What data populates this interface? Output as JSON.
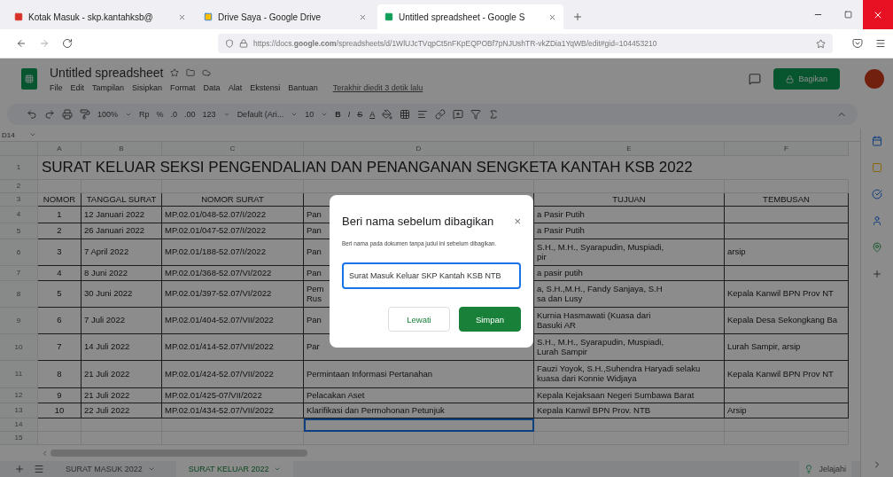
{
  "browser": {
    "tabs": [
      {
        "title": "Kotak Masuk - skp.kantahksb@",
        "selected": false
      },
      {
        "title": "Drive Saya - Google Drive",
        "selected": false
      },
      {
        "title": "Untitled spreadsheet - Google S",
        "selected": true
      }
    ],
    "url": "https://docs.**google.com**/spreadsheets/d/1WlUJcTVqpCt5nFKpEQPOBf7pNJUshTR-vkZDia1YqWB/edit#gid=104453210"
  },
  "document": {
    "title": "Untitled spreadsheet",
    "menu": [
      "File",
      "Edit",
      "Tampilan",
      "Sisipkan",
      "Format",
      "Data",
      "Alat",
      "Ekstensi",
      "Bantuan"
    ],
    "last_edit": "Terakhir diedit 3 detik lalu",
    "share_button": "Bagikan"
  },
  "toolbar": {
    "zoom": "100%",
    "currency": "Rp",
    "percent": "%",
    "decimal_less": ".0",
    "decimal_more": ".00",
    "number_format": "123",
    "font": "Default (Ari...",
    "font_size": "10",
    "bold": "B",
    "italic": "I",
    "strike": "S",
    "text_color": "A"
  },
  "name_box": "D14",
  "sheet": {
    "columns": [
      "A",
      "B",
      "C",
      "D",
      "E",
      "F"
    ],
    "rows": [
      {
        "number": "1",
        "kind": "title",
        "text": "SURAT KELUAR SEKSI PENGENDALIAN DAN PENANGANAN SENGKETA KANTAH KSB 2022"
      },
      {
        "number": "2",
        "kind": "blank"
      },
      {
        "number": "3",
        "kind": "header",
        "cells": {
          "A": "NOMOR",
          "B": "TANGGAL SURAT",
          "C": "NOMOR SURAT",
          "E": "TUJUAN",
          "F": "TEMBUSAN"
        }
      },
      {
        "number": "4",
        "kind": "data",
        "cells": {
          "A": "1",
          "B": "12 Januari 2022",
          "C": "MP.02.01/048-52.07/I/2022",
          "D": "Pan",
          "E": "a Pasir Putih"
        }
      },
      {
        "number": "5",
        "kind": "data",
        "cells": {
          "A": "2",
          "B": "26 Januari 2022",
          "C": "MP.02.01/047-52.07/I/2022",
          "D": "Pan",
          "E": "a Pasir Putih"
        }
      },
      {
        "number": "6",
        "kind": "data",
        "cells": {
          "A": "3",
          "B": "7 April 2022",
          "C": "MP.02.01/188-52.07/I/2022",
          "D": "Pan",
          "E": "S.H., M.H., Syarapudin, Muspiadi,\npir",
          "F": "arsip"
        }
      },
      {
        "number": "7",
        "kind": "data",
        "cells": {
          "A": "4",
          "B": "8 Juni 2022",
          "C": "MP.02.01/368-52.07/VI/2022",
          "D": "Pan",
          "E": "a pasir putih"
        }
      },
      {
        "number": "8",
        "kind": "data",
        "cells": {
          "A": "5",
          "B": "30 Juni 2022",
          "C": "MP.02.01/397-52.07/VI/2022",
          "D": "Pem\nRus",
          "E": "a, S.H.,M.H., Fandy Sanjaya, S.H\nsa dan Lusy",
          "F": "Kepala Kanwil BPN Prov NT"
        }
      },
      {
        "number": "9",
        "kind": "data",
        "cells": {
          "A": "6",
          "B": "7 Juli 2022",
          "C": "MP.02.01/404-52.07/VII/2022",
          "D": "Pan",
          "E": "Kurnia Hasmawati (Kuasa dari\nBasuki AR",
          "F": "Kepala Desa Sekongkang Ba"
        }
      },
      {
        "number": "10",
        "kind": "data",
        "cells": {
          "A": "7",
          "B": "14 Juli 2022",
          "C": "MP.02.01/414-52.07/VII/2022",
          "D": "Par",
          "E": "S.H., M.H., Syarapudin, Muspiadi,\nLurah Sampir",
          "F": "Lurah Sampir, arsip"
        }
      },
      {
        "number": "11",
        "kind": "data",
        "cells": {
          "A": "8",
          "B": "21 Juli 2022",
          "C": "MP.02.01/424-52.07/VII/2022",
          "D": "Permintaan Informasi Pertanahan",
          "E": "Fauzi Yoyok, S.H.,Suhendra Haryadi selaku\nkuasa dari Konnie Widjaya",
          "F": "Kepala Kanwil BPN Prov NT"
        }
      },
      {
        "number": "12",
        "kind": "data",
        "cells": {
          "A": "9",
          "B": "21 Juli 2022",
          "C": "MP.02.01/425-07/VII/2022",
          "D": "Pelacakan Aset",
          "E": "Kepala Kejaksaan Negeri Sumbawa Barat"
        }
      },
      {
        "number": "13",
        "kind": "data",
        "cells": {
          "A": "10",
          "B": "22 Juli 2022",
          "C": "MP.02.01/434-52.07/VII/2022",
          "D": "Klarifikasi dan Permohonan Petunjuk",
          "E": "Kepala Kanwil BPN Prov. NTB",
          "F": "Arsip"
        }
      },
      {
        "number": "14",
        "kind": "blank",
        "cells_selected": [
          false,
          false,
          false,
          true,
          false,
          false
        ]
      },
      {
        "number": "15",
        "kind": "blank"
      }
    ]
  },
  "sheet_tabs": [
    {
      "label": "SURAT MASUK 2022",
      "selected": false
    },
    {
      "label": "SURAT KELUAR 2022",
      "selected": true
    }
  ],
  "explore_button": "Jelajahi",
  "dialog": {
    "title": "Beri nama sebelum dibagikan",
    "close": "×",
    "description": "Beri nama pada dokumen tanpa judul ini sebelum dibagikan.",
    "value": "Surat Masuk Keluar SKP Kantah KSB NTB",
    "buttons": [
      "Lewati",
      "Simpan"
    ]
  }
}
